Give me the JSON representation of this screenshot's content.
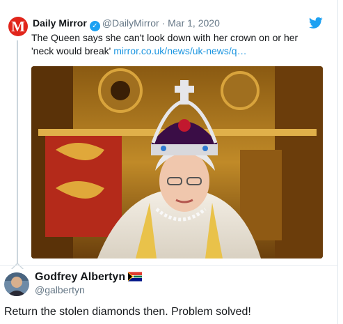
{
  "quoted_tweet": {
    "avatar_letter": "M",
    "author_name": "Daily Mirror",
    "handle": "@DailyMirror",
    "separator": "·",
    "date": "Mar 1, 2020",
    "text": "The Queen says she can't look down with her crown on or her 'neck would break'",
    "link": "mirror.co.uk/news/uk-news/q…",
    "verified_icon": "verified-badge-icon",
    "brand_icon": "twitter-bird-icon",
    "image": "photo-of-the-queen-wearing-crown"
  },
  "reply": {
    "author_name": "Godfrey Albertyn",
    "handle": "@galbertyn",
    "flag_icon": "south-africa-flag-icon",
    "text": "Return the stolen diamonds then. Problem solved!"
  },
  "colors": {
    "link": "#1b95e0",
    "twitter_blue": "#1da1f2",
    "mirror_red": "#e1251b",
    "muted": "#657786"
  }
}
